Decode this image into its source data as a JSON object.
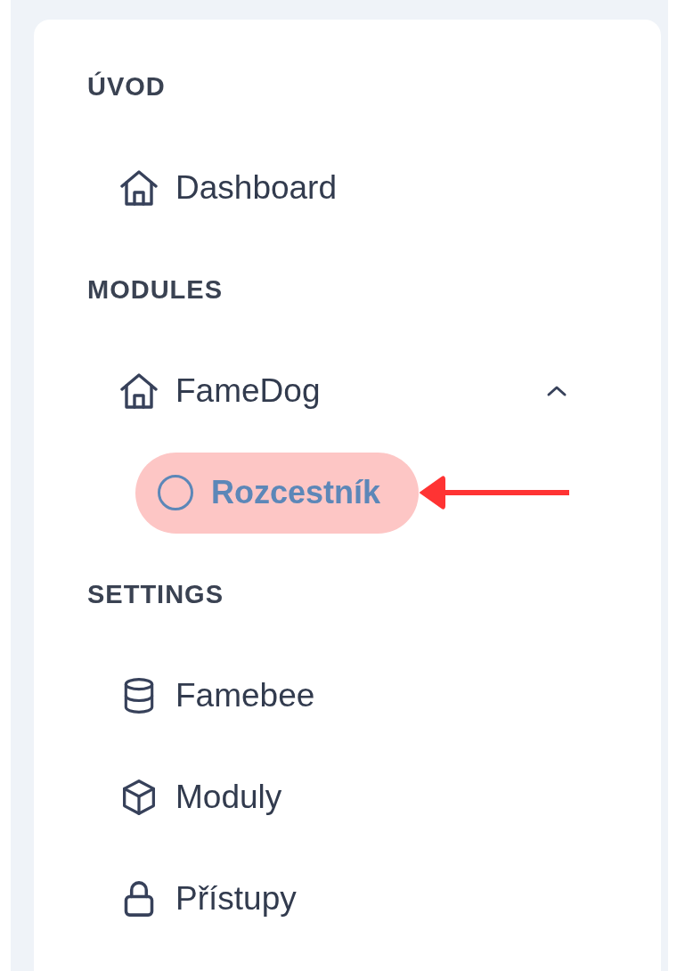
{
  "sidebar": {
    "sections": [
      {
        "title": "ÚVOD",
        "items": [
          {
            "label": "Dashboard",
            "selected": false
          }
        ]
      },
      {
        "title": "MODULES",
        "items": [
          {
            "label": "FameDog",
            "selected": false,
            "expanded": true,
            "children": [
              {
                "label": "Rozcestník",
                "selected": true,
                "pointed_at": true
              }
            ]
          }
        ]
      },
      {
        "title": "SETTINGS",
        "items": [
          {
            "label": "Famebee",
            "selected": false
          },
          {
            "label": "Moduly",
            "selected": false
          },
          {
            "label": "Přístupy",
            "selected": false
          }
        ]
      }
    ]
  }
}
